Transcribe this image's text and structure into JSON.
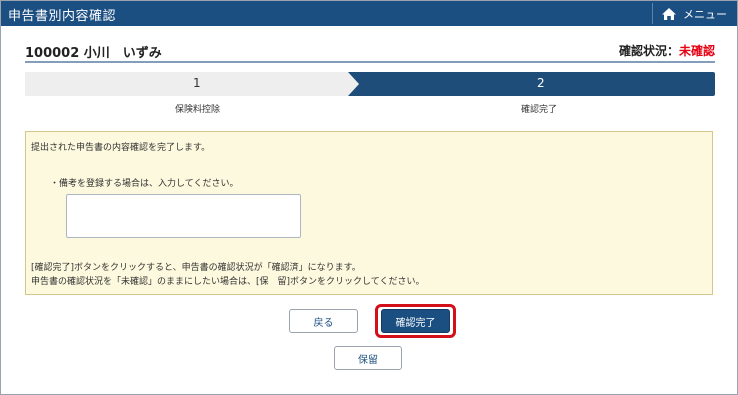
{
  "window": {
    "title": "申告書別内容確認"
  },
  "header": {
    "menu_label": "メニュー",
    "menu_icon": "home-icon"
  },
  "user": {
    "id_name": "100002  小川　いずみ",
    "status_label": "確認状況：",
    "status_value": "未確認",
    "status_color": "#e60012"
  },
  "steps": [
    {
      "number": "1",
      "label": "保険料控除",
      "state": "done"
    },
    {
      "number": "2",
      "label": "確認完了",
      "state": "current"
    }
  ],
  "notice": {
    "intro": "提出された申告書の内容確認を完了します。",
    "remark_label": "・備考を登録する場合は、入力してください。",
    "remark_value": "",
    "note1": "[確認完了]ボタンをクリックすると、申告書の確認状況が「確認済」になります。",
    "note2": "申告書の確認状況を「未確認」のままにしたい場合は、[保　留]ボタンをクリックしてください。"
  },
  "buttons": {
    "back": "戻る",
    "confirm": "確認完了",
    "hold": "保留"
  },
  "colors": {
    "primary": "#1b4f82",
    "notice_bg": "#fdf9de",
    "highlight": "#d3101a"
  }
}
